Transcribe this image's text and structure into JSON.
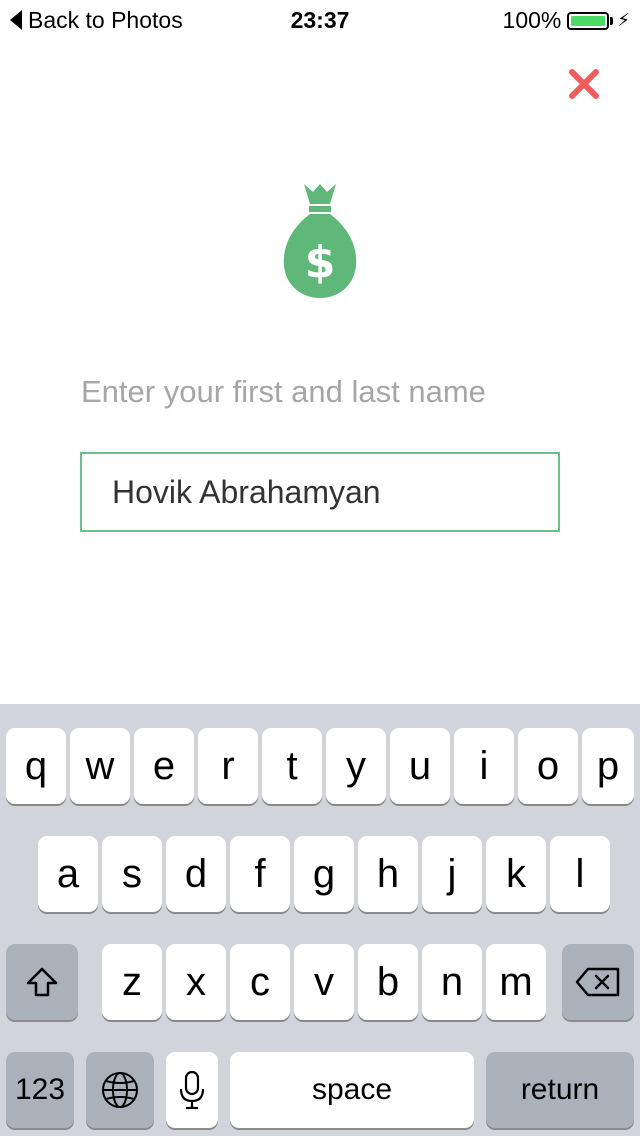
{
  "status_bar": {
    "back_label": "Back to Photos",
    "time": "23:37",
    "battery_text": "100%"
  },
  "form": {
    "prompt": "Enter your first and last name",
    "name_value": "Hovik Abrahamyan"
  },
  "colors": {
    "accent_green": "#5fb87a",
    "close_red": "#ef5d5d",
    "input_border": "#6cc08b"
  },
  "icons": {
    "close": "close-icon",
    "money_bag": "money-bag-icon"
  },
  "keyboard": {
    "row1": [
      "q",
      "w",
      "e",
      "r",
      "t",
      "y",
      "u",
      "i",
      "o",
      "p"
    ],
    "row2": [
      "a",
      "s",
      "d",
      "f",
      "g",
      "h",
      "j",
      "k",
      "l"
    ],
    "row3": [
      "z",
      "x",
      "c",
      "v",
      "b",
      "n",
      "m"
    ],
    "numbers_label": "123",
    "space_label": "space",
    "return_label": "return"
  }
}
